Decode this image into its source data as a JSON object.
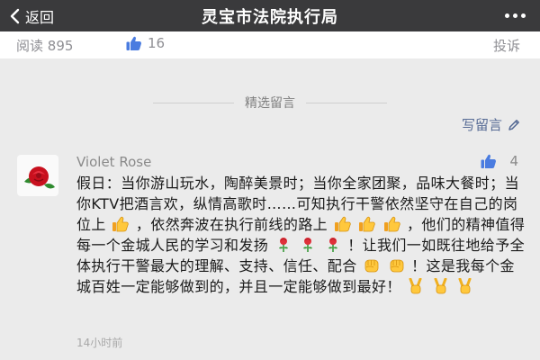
{
  "header": {
    "back_label": "返回",
    "title": "灵宝市法院执行局"
  },
  "stats": {
    "reads_label": "阅读",
    "reads_count": "895",
    "likes_count": "16",
    "report_label": "投诉"
  },
  "comments_section": {
    "title": "精选留言",
    "write_label": "写留言"
  },
  "comment": {
    "author": "Violet Rose",
    "likes": "4",
    "time": "14小时前",
    "segments": {
      "s1": "假日：当你游山玩水，陶醉美景时；当你全家团聚，品味大餐时；当你KTV把酒言欢，纵情高歌时……可知执行干警依然坚守在自己的岗位上",
      "s2": "，依然奔波在执行前线的路上",
      "s3": "，他们的精神值得每一个金城人民的学习和发扬",
      "s4": "！让我们一如既往地给予全体执行干警最大的理解、支持、信任、配合",
      "s5": "！这是我每个金城百姓一定能够做到的，并且一定能够做到最好！"
    },
    "emoji_icons": [
      "thumbs-up-icon",
      "rose-icon",
      "fist-icon",
      "victory-hand-icon"
    ]
  },
  "colors": {
    "topbar": "#3a3a3c",
    "link_blue": "#576b95",
    "like_blue": "#4a7ce0",
    "page_bg": "#ebebeb"
  }
}
